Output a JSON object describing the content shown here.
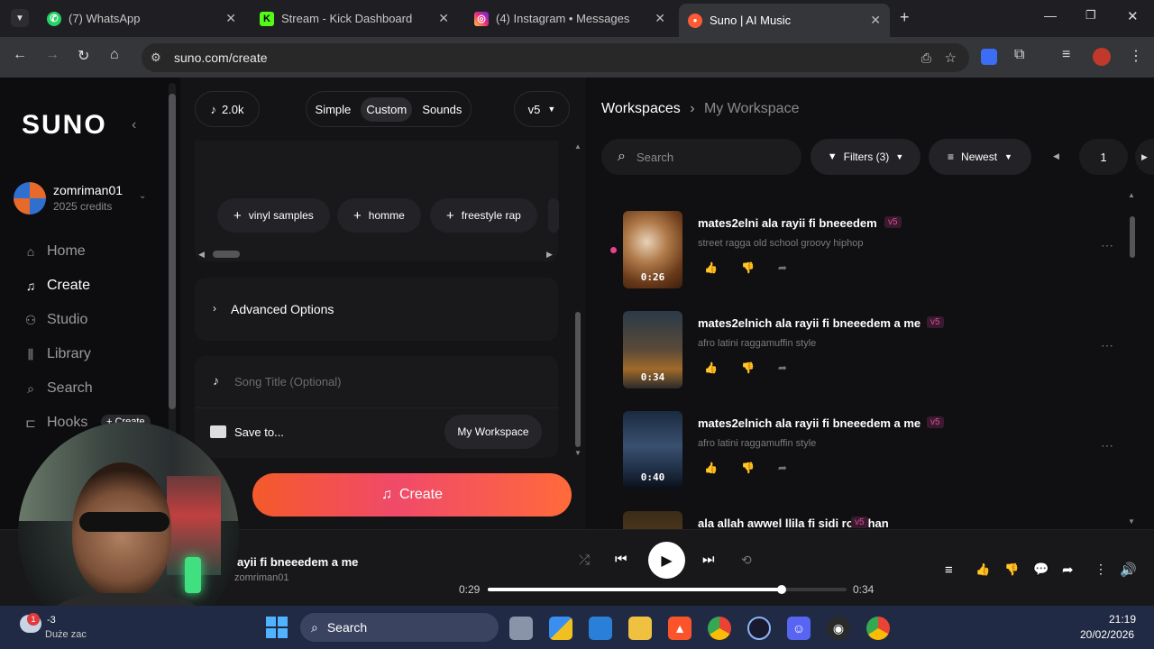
{
  "browser": {
    "tabs": [
      {
        "label": "(7) WhatsApp",
        "icon": "whatsapp-icon",
        "color": "#25d366"
      },
      {
        "label": "Stream - Kick Dashboard",
        "icon": "kick-icon",
        "color": "#53fc18"
      },
      {
        "label": "(4) Instagram • Messages",
        "icon": "instagram-icon",
        "color": "#e1306c"
      },
      {
        "label": "Suno | AI Music",
        "icon": "suno-icon",
        "color": "#ff5a36"
      }
    ],
    "url": "suno.com/create"
  },
  "sidebar": {
    "logo": "SUNO",
    "user": {
      "name": "zomriman01",
      "credits": "2025 credits"
    },
    "items": [
      {
        "label": "Home",
        "icon": "home-icon"
      },
      {
        "label": "Create",
        "icon": "music-note-icon"
      },
      {
        "label": "Studio",
        "icon": "studio-icon"
      },
      {
        "label": "Library",
        "icon": "library-icon"
      },
      {
        "label": "Search",
        "icon": "search-icon"
      },
      {
        "label": "Hooks",
        "icon": "hooks-icon"
      }
    ],
    "hooks_create": "+ Create"
  },
  "create": {
    "credits_count": "2.0k",
    "modes": [
      "Simple",
      "Custom",
      "Sounds"
    ],
    "active_mode": "Custom",
    "version": "v5",
    "tags": [
      "vinyl samples",
      "homme",
      "freestyle rap"
    ],
    "advanced": "Advanced Options",
    "title_placeholder": "Song Title (Optional)",
    "save_to": "Save to...",
    "workspace": "My Workspace",
    "create_button": "Create"
  },
  "workspace": {
    "breadcrumb_root": "Workspaces",
    "breadcrumb_current": "My Workspace",
    "search_placeholder": "Search",
    "filters": "Filters (3)",
    "sort": "Newest",
    "page": "1",
    "songs": [
      {
        "title": "mates2elni ala rayii fi bneeedem",
        "style": "street ragga old school groovy hiphop",
        "duration": "0:26",
        "version": "v5"
      },
      {
        "title": "mates2elnich ala rayii fi bneeedem a me",
        "style": "afro latini raggamuffin style",
        "duration": "0:34",
        "version": "v5"
      },
      {
        "title": "mates2elnich ala rayii fi bneeedem a me",
        "style": "afro latini raggamuffin style",
        "duration": "0:40",
        "version": "v5"
      },
      {
        "title": "ala allah awwel llila fi sidi romthan",
        "style": "",
        "duration": "",
        "version": "v5"
      }
    ]
  },
  "player": {
    "title": "ayii fi bneeedem a me",
    "artist": "zomriman01",
    "elapsed": "0:29",
    "total": "0:34",
    "progress": 0.82
  },
  "taskbar": {
    "weather_temp": "-3",
    "weather_text": "Duże zac",
    "search": "Search",
    "time": "21:19",
    "date": "20/02/2026",
    "notification_badge": "1"
  }
}
